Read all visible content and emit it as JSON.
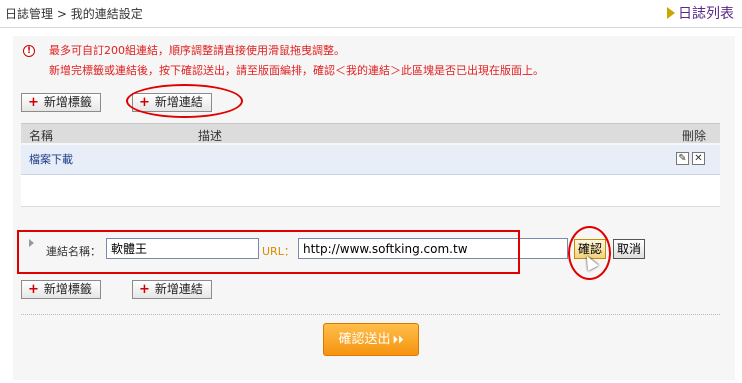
{
  "breadcrumb": {
    "root": "日誌管理",
    "sep": ">",
    "current": "我的連結設定"
  },
  "top_link": {
    "label": "日誌列表"
  },
  "notice": {
    "line1": "最多可自訂200組連結，順序調整請直接使用滑鼠拖曳調整。",
    "line2": "新增完標籤或連結後，按下確認送出，請至版面編排，確認＜我的連結＞此區塊是否已出現在版面上。"
  },
  "toolbar": {
    "add_label": "新增標籤",
    "add_link": "新增連結"
  },
  "table": {
    "headers": {
      "name": "名稱",
      "desc": "描述",
      "delete": "刪除"
    },
    "rows": [
      {
        "name": "檔案下載",
        "desc": ""
      }
    ]
  },
  "form": {
    "name_label": "連結名稱：",
    "name_value": "軟體王",
    "url_label": "URL：",
    "url_value": "http://www.softking.com.tw",
    "confirm": "確認",
    "cancel": "取消"
  },
  "bottom_toolbar": {
    "add_label": "新增標籤",
    "add_link": "新增連結"
  },
  "submit": {
    "label": "確認送出",
    "arrow": "⏵⏵"
  },
  "colors": {
    "accent": "#e00000",
    "submit": "#f5940f",
    "link": "#1f3e8a",
    "url_label": "#d88a00"
  },
  "icons": [
    "warning-icon",
    "plus-icon",
    "edit-icon",
    "delete-icon",
    "triangle-right-icon",
    "cursor-icon"
  ]
}
